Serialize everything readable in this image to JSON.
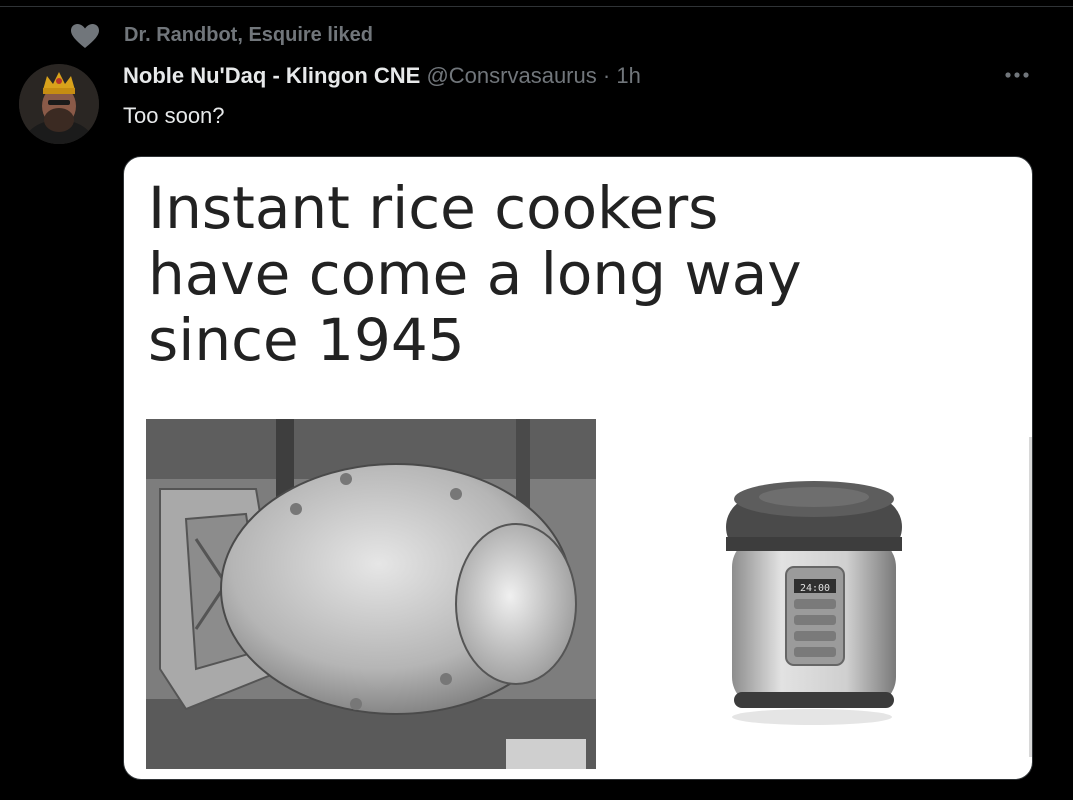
{
  "social_context": {
    "icon": "heart-icon",
    "text": "Dr. Randbot, Esquire liked"
  },
  "tweet": {
    "author_name": "Noble Nu'Daq - Klingon CNE",
    "author_handle": "@Consrvasaurus",
    "separator": "·",
    "time": "1h",
    "text": "Too soon?",
    "more_icon": "more-horizontal-icon"
  },
  "media": {
    "caption_lines": [
      "Instant rice cookers",
      "have come a long way",
      "since 1945"
    ],
    "left_image": "atomic-bomb-photo",
    "right_image": "rice-cooker-photo",
    "cooker_display": "24:00"
  },
  "colors": {
    "background": "#000000",
    "text_primary": "#e7e9ea",
    "text_secondary": "#71767b",
    "media_background": "#ffffff"
  }
}
